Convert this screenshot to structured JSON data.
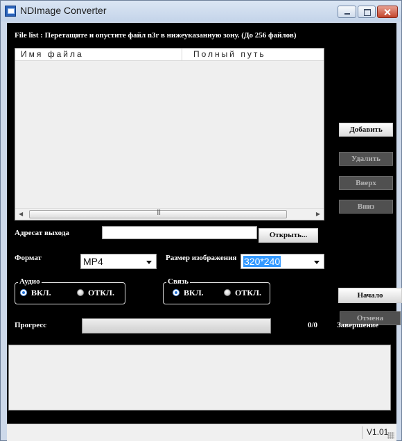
{
  "window": {
    "title": "NDImage Converter"
  },
  "file_list": {
    "label": "File list : Перетащите и опустите файл n3r в нижеуказанную зону.  (До 256 файлов)",
    "columns": [
      "Имя файла",
      "Полный путь"
    ],
    "rows": [],
    "scrollbar_grip": "|||"
  },
  "side_buttons": {
    "add": "Добавить",
    "delete": "Удалить",
    "up": "Вверх",
    "down": "Вниз"
  },
  "output": {
    "label": "Адресат выхода",
    "path_value": "",
    "open_button": "Открыть..."
  },
  "format": {
    "label": "Формат",
    "selected": "MP4"
  },
  "image_size": {
    "label": "Размер изображения",
    "selected": "320*240"
  },
  "audio": {
    "group_label": "Аудио",
    "on_label": "ВКЛ.",
    "off_label": "ОТКЛ.",
    "selected": "on"
  },
  "link": {
    "group_label": "Связь",
    "on_label": "ВКЛ.",
    "off_label": "ОТКЛ.",
    "selected": "on"
  },
  "actions": {
    "start": "Начало",
    "cancel": "Отмена"
  },
  "progress": {
    "label": "Прогресс",
    "value": 0,
    "count": "0/0",
    "status": "Завершение"
  },
  "log": {
    "text": ""
  },
  "statusbar": {
    "version": "V1.01"
  }
}
